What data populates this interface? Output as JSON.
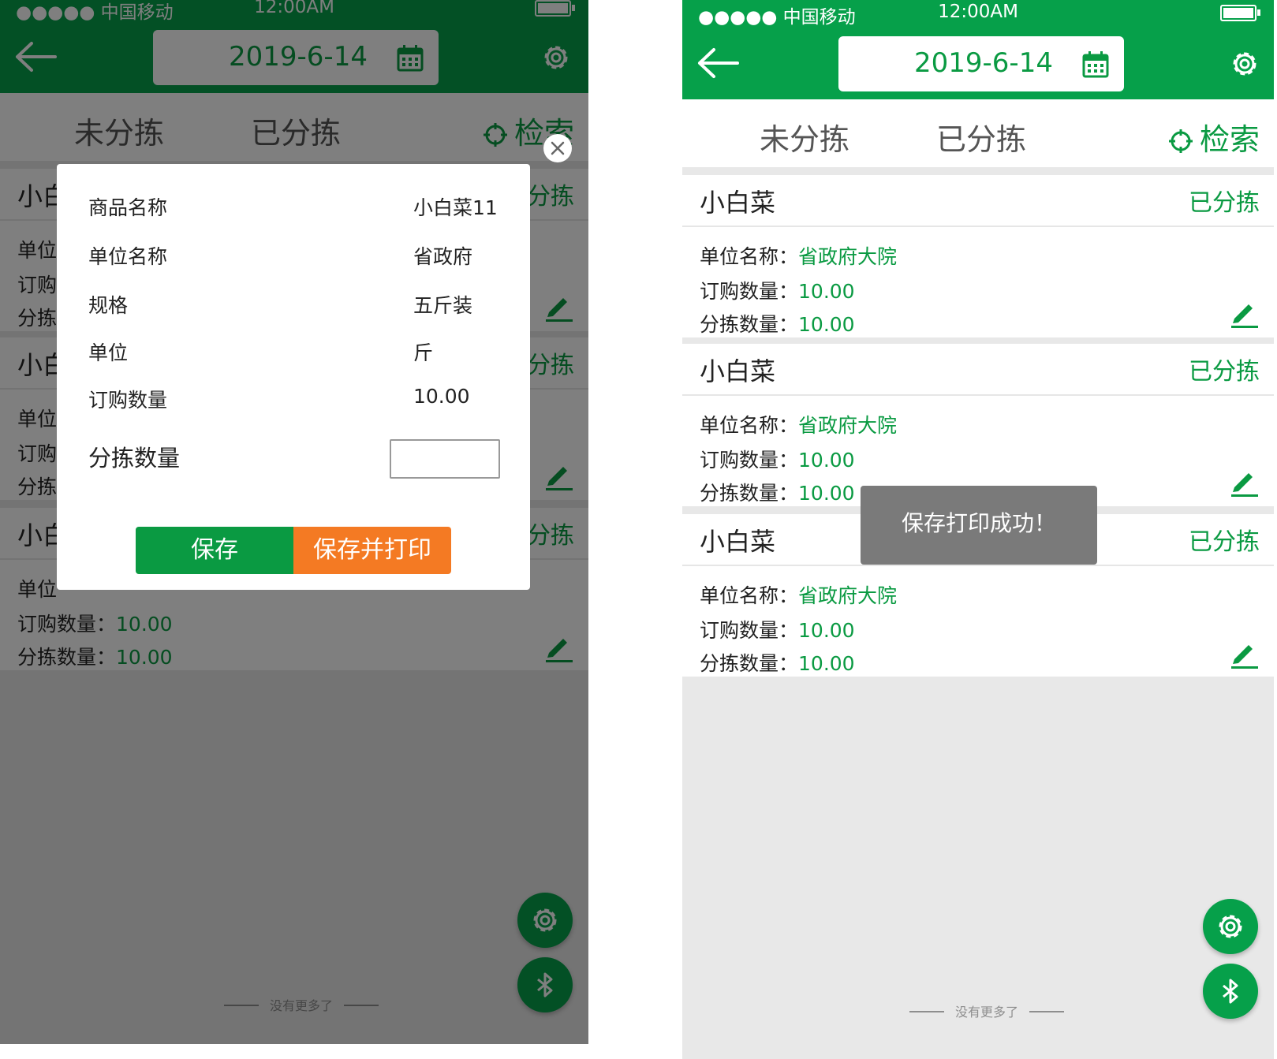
{
  "statusbar": {
    "carrier": "●●●●● 中国移动",
    "time": "12:00AM"
  },
  "header": {
    "date": "2019-6-14"
  },
  "tabs": {
    "unsorted": "未分拣",
    "sorted": "已分拣",
    "search": "检索"
  },
  "left_cards": [
    {
      "name": "小白",
      "status": "分拣",
      "unit_label": "单位",
      "order_label": "订购",
      "sort_label": "分拣"
    },
    {
      "name": "小白",
      "status": "分拣",
      "unit_label": "单位",
      "order_label": "订购",
      "sort_label": "分拣"
    },
    {
      "name": "小白",
      "status": "分拣",
      "unit_label": "单位",
      "order_label": "订购数量：",
      "order_value": "10.00",
      "sort_label": "分拣数量：",
      "sort_value": "10.00"
    }
  ],
  "right_cards": [
    {
      "name": "小白菜",
      "status": "已分拣",
      "unit_label": "单位名称：",
      "unit_value": "省政府大院",
      "order_label": "订购数量：",
      "order_value": "10.00",
      "sort_label": "分拣数量：",
      "sort_value": "10.00"
    },
    {
      "name": "小白菜",
      "status": "已分拣",
      "unit_label": "单位名称：",
      "unit_value": "省政府大院",
      "order_label": "订购数量：",
      "order_value": "10.00",
      "sort_label": "分拣数量：",
      "sort_value": "10.00"
    },
    {
      "name": "小白菜",
      "status": "已分拣",
      "unit_label": "单位名称：",
      "unit_value": "省政府大院",
      "order_label": "订购数量：",
      "order_value": "10.00",
      "sort_label": "分拣数量：",
      "sort_value": "10.00"
    }
  ],
  "modal": {
    "rows": [
      {
        "label": "商品名称",
        "value": "小白菜11"
      },
      {
        "label": "单位名称",
        "value": "省政府"
      },
      {
        "label": "规格",
        "value": "五斤装"
      },
      {
        "label": "单位",
        "value": "斤"
      },
      {
        "label": "订购数量",
        "value": "10.00"
      }
    ],
    "qty_label": "分拣数量",
    "qty_value": "",
    "save_label": "保存",
    "save_print_label": "保存并打印"
  },
  "toast": "保存打印成功！",
  "footer": "没有更多了",
  "icons": {
    "back": "arrow-left-icon",
    "calendar": "calendar-icon",
    "settings": "gear-icon",
    "search": "crosshair-icon",
    "edit": "pencil-icon",
    "bluetooth": "bluetooth-icon",
    "close": "close-icon"
  },
  "colors": {
    "brand_green": "#06a04a",
    "text_green": "#0a9a42",
    "accent_orange": "#f47a23",
    "overlay": "rgba(0,0,0,0.5)"
  }
}
